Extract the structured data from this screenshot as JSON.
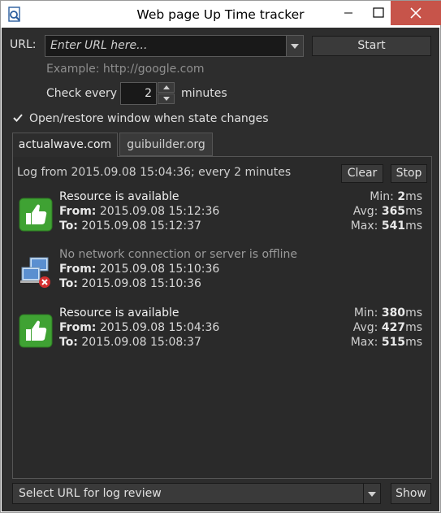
{
  "window": {
    "title": "Web page Up Time tracker"
  },
  "url": {
    "label": "URL:",
    "placeholder": "Enter URL here...",
    "example": "Example: http://google.com",
    "start_label": "Start"
  },
  "interval": {
    "label": "Check every",
    "value": "2",
    "unit": "minutes"
  },
  "option": {
    "label": "Open/restore window when state changes",
    "checked": true
  },
  "tabs": [
    {
      "label": "actualwave.com",
      "active": true
    },
    {
      "label": "guibuilder.org",
      "active": false
    }
  ],
  "log": {
    "header": "Log from 2015.09.08 15:04:36; every 2 minutes",
    "clear_label": "Clear",
    "stop_label": "Stop",
    "from_label": "From:",
    "to_label": "To:",
    "min_label": "Min:",
    "avg_label": "Avg:",
    "max_label": "Max:",
    "unit": "ms",
    "entries": [
      {
        "icon": "thumbs-up-icon",
        "status": "Resource is available",
        "from": "2015.09.08 15:12:36",
        "to": "2015.09.08 15:12:37",
        "min": "2",
        "avg": "365",
        "max": "541"
      },
      {
        "icon": "network-offline-icon",
        "status": "No network connection or server is offline",
        "from": "2015.09.08 15:10:36",
        "to": "2015.09.08 15:10:36"
      },
      {
        "icon": "thumbs-up-icon",
        "status": "Resource is available",
        "from": "2015.09.08 15:04:36",
        "to": "2015.09.08 15:08:37",
        "min": "380",
        "avg": "427",
        "max": "515"
      }
    ]
  },
  "footer": {
    "select_text": "Select URL for log review",
    "show_label": "Show"
  },
  "colors": {
    "background": "#2d2d2d",
    "close_button": "#c7544a",
    "ok_icon": "#3fa233"
  }
}
